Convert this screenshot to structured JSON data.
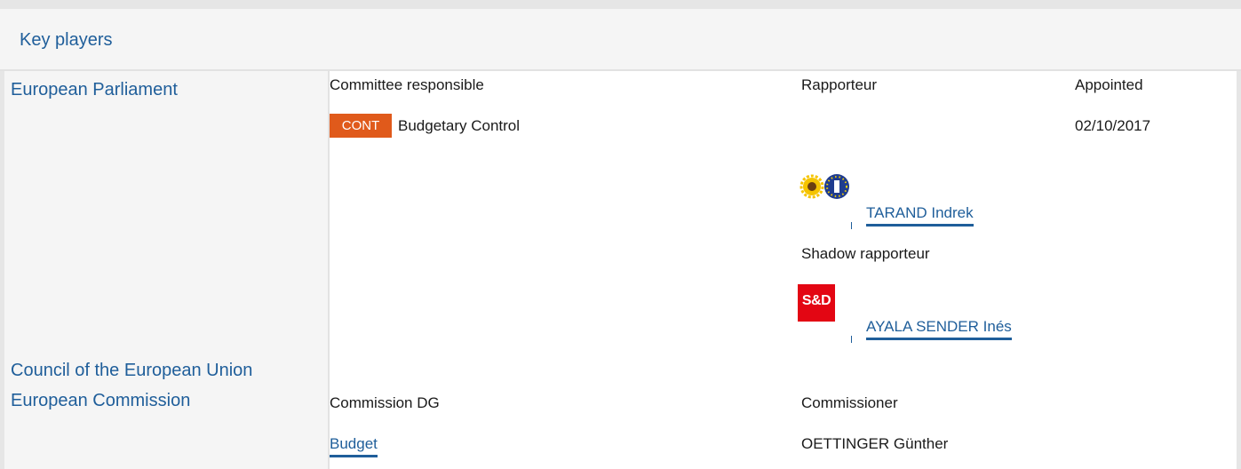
{
  "header": {
    "title": "Key players"
  },
  "institutions": {
    "ep": "European Parliament",
    "council": "Council of the European Union",
    "commission": "European Commission"
  },
  "parliament": {
    "col_committee": "Committee responsible",
    "col_rapporteur": "Rapporteur",
    "col_appointed": "Appointed",
    "committee_code": "CONT",
    "committee_name": "Budgetary Control",
    "appointed_date": "02/10/2017",
    "rapporteur_name": "TARAND Indrek",
    "shadow_label": "Shadow rapporteur",
    "shadow_name": "AYALA SENDER Inés",
    "shadow_group_logo_text": "S&D"
  },
  "commission": {
    "col_dg": "Commission DG",
    "col_commissioner": "Commissioner",
    "dg_name": "Budget",
    "commissioner_name": "OETTINGER Günther"
  },
  "icons": {
    "greens_logo": "greens-efa-logo-icon",
    "sd_logo": "sd-group-logo-icon"
  },
  "colors": {
    "link": "#1f5e9a",
    "badge": "#e05a1b",
    "sd_red": "#e30613"
  }
}
